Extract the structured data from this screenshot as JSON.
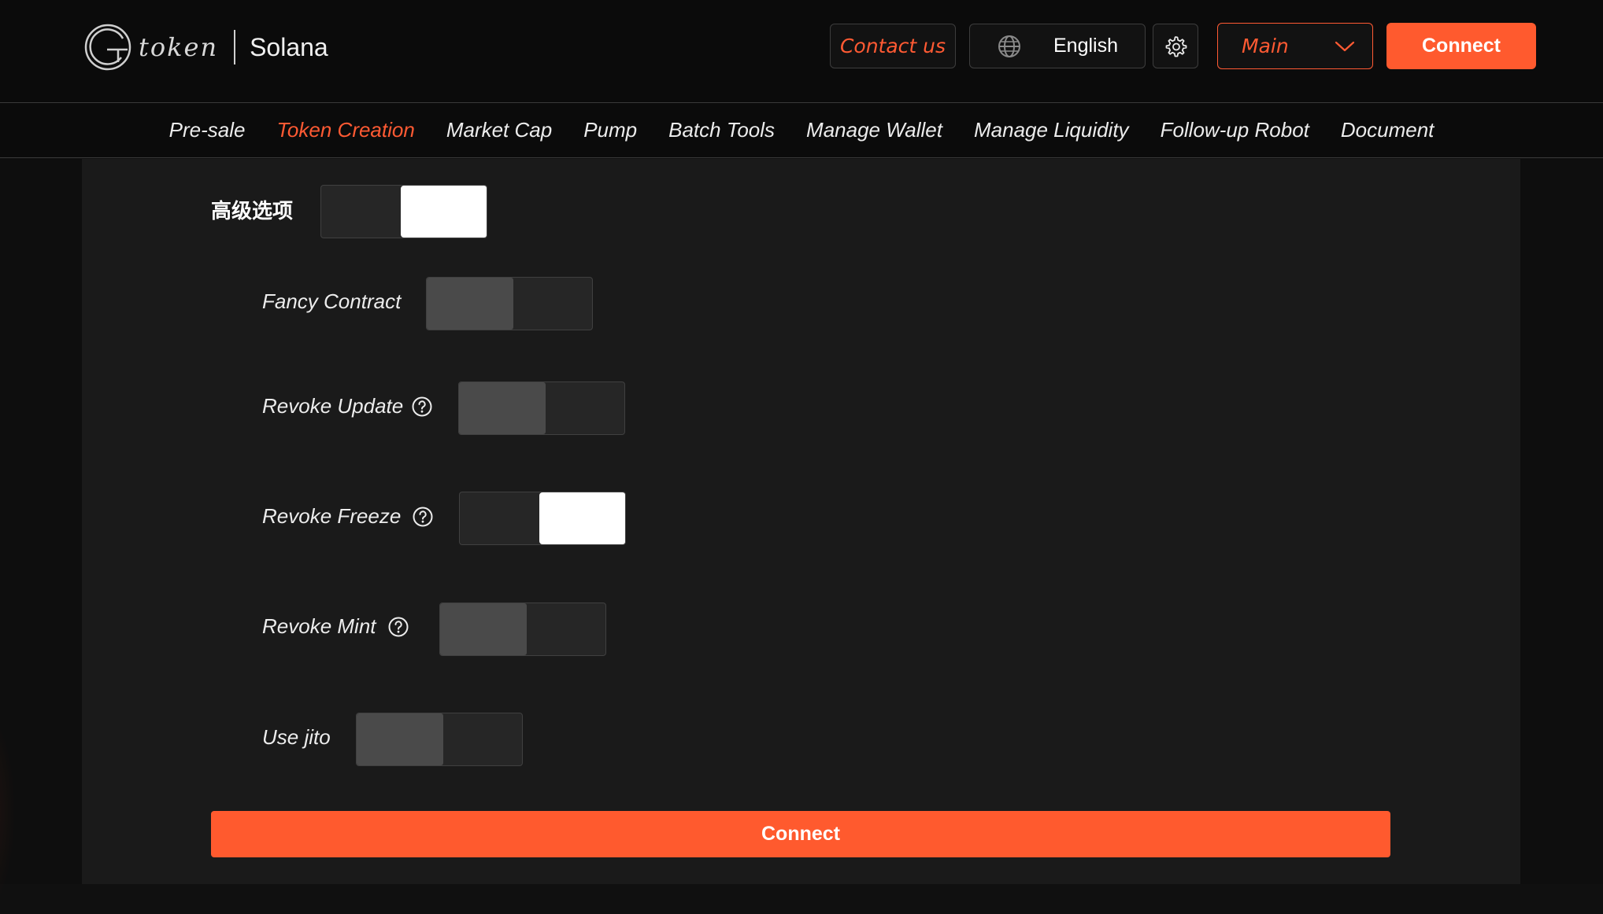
{
  "header": {
    "logo_word": "token",
    "chain": "Solana",
    "contact_label": "Contact us",
    "language_label": "English",
    "network_label": "Main",
    "connect_label": "Connect"
  },
  "nav": {
    "items": [
      {
        "label": "Pre-sale",
        "active": false
      },
      {
        "label": "Token Creation",
        "active": true
      },
      {
        "label": "Market Cap",
        "active": false
      },
      {
        "label": "Pump",
        "active": false
      },
      {
        "label": "Batch Tools",
        "active": false
      },
      {
        "label": "Manage Wallet",
        "active": false
      },
      {
        "label": "Manage Liquidity",
        "active": false
      },
      {
        "label": "Follow-up Robot",
        "active": false
      },
      {
        "label": "Document",
        "active": false
      }
    ]
  },
  "form": {
    "advanced_label": "高级选项",
    "advanced_on": true,
    "options": [
      {
        "label": "Fancy Contract",
        "help": false,
        "on": false
      },
      {
        "label": "Revoke Update",
        "help": true,
        "on": false
      },
      {
        "label": "Revoke Freeze",
        "help": true,
        "on": true
      },
      {
        "label": "Revoke Mint",
        "help": true,
        "on": false
      },
      {
        "label": "Use jito",
        "help": false,
        "on": false
      }
    ],
    "submit_label": "Connect"
  },
  "colors": {
    "accent": "#ff5a2e",
    "background": "#1a1a1a",
    "header": "#0b0b0b"
  },
  "icons": [
    "globe-icon",
    "gear-icon",
    "chevron-down-icon",
    "help-circle-icon"
  ]
}
